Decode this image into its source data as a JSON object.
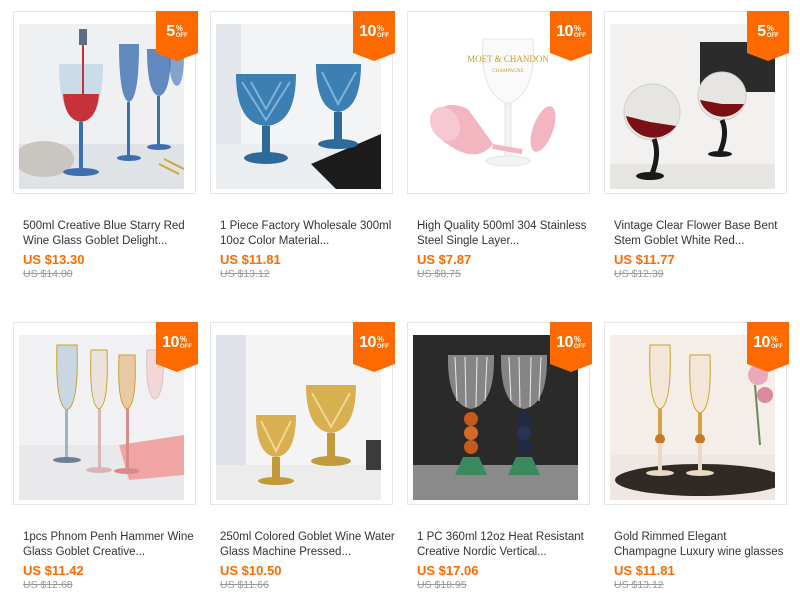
{
  "products": [
    {
      "title": "500ml Creative Blue Starry Red Wine Glass Goblet Delight...",
      "price": "US $13.30",
      "old_price": "US $14.00",
      "discount": "5",
      "pct": "%",
      "off": "OFF"
    },
    {
      "title": "1 Piece Factory Wholesale 300ml 10oz Color Material...",
      "price": "US $11.81",
      "old_price": "US $13.12",
      "discount": "10",
      "pct": "%",
      "off": "OFF"
    },
    {
      "title": "High Quality 500ml 304 Stainless Steel Single Layer...",
      "price": "US $7.87",
      "old_price": "US $8.75",
      "discount": "10",
      "pct": "%",
      "off": "OFF"
    },
    {
      "title": "Vintage Clear Flower Base Bent Stem Goblet White Red...",
      "price": "US $11.77",
      "old_price": "US $12.39",
      "discount": "5",
      "pct": "%",
      "off": "OFF"
    },
    {
      "title": "1pcs Phnom Penh Hammer Wine Glass Goblet Creative...",
      "price": "US $11.42",
      "old_price": "US $12.68",
      "discount": "10",
      "pct": "%",
      "off": "OFF"
    },
    {
      "title": "250ml Colored Goblet Wine Water Glass Machine Pressed...",
      "price": "US $10.50",
      "old_price": "US $11.66",
      "discount": "10",
      "pct": "%",
      "off": "OFF"
    },
    {
      "title": "1 PC 360ml 12oz Heat Resistant Creative Nordic Vertical...",
      "price": "US $17.06",
      "old_price": "US $18.95",
      "discount": "10",
      "pct": "%",
      "off": "OFF"
    },
    {
      "title": "Gold Rimmed Elegant Champagne Luxury wine glasses Long...",
      "price": "US $11.81",
      "old_price": "US $13.12",
      "discount": "10",
      "pct": "%",
      "off": "OFF"
    }
  ],
  "product_image_text": {
    "moet_bottle_text": "MOET & CHANDON",
    "moet_sub_text": "CHAMPAGNE"
  },
  "colors": {
    "accent": "#ff6a00",
    "old_price": "#999999",
    "title": "#333333"
  }
}
